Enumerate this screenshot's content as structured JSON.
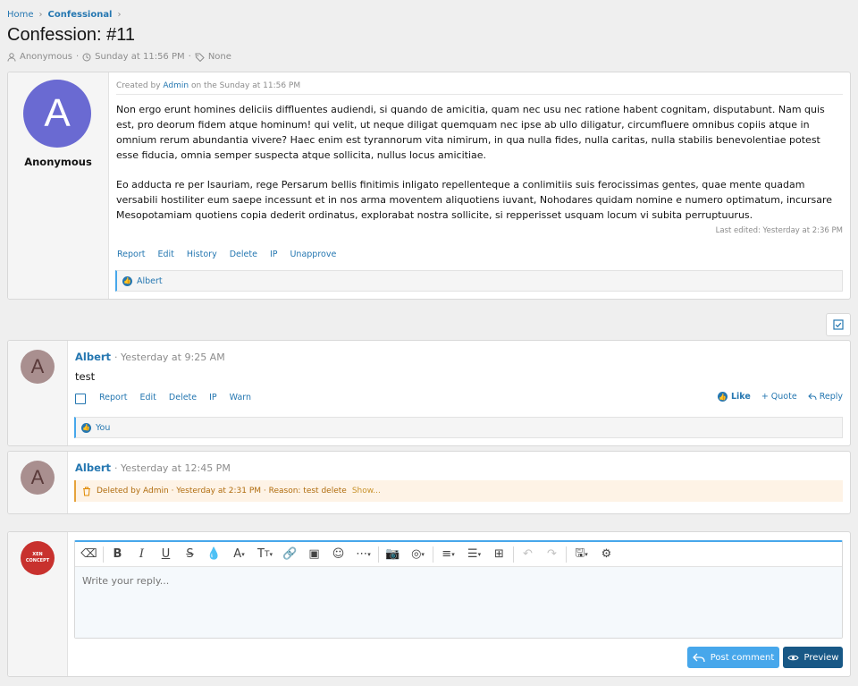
{
  "breadcrumb": {
    "home": "Home",
    "current": "Confessional"
  },
  "page": {
    "title": "Confession: #11",
    "meta_author": "Anonymous",
    "meta_date": "Sunday at 11:56 PM",
    "meta_tags": "None"
  },
  "confession": {
    "avatar_letter": "A",
    "avatar_color": "#6a6ad2",
    "username": "Anonymous",
    "created_prefix": "Created by",
    "created_by": "Admin",
    "created_suffix": "on the Sunday at 11:56 PM",
    "paragraph1": "Non ergo erunt homines deliciis diffluentes audiendi, si quando de amicitia, quam nec usu nec ratione habent cognitam, disputabunt. Nam quis est, pro deorum fidem atque hominum! qui velit, ut neque diligat quemquam nec ipse ab ullo diligatur, circumfluere omnibus copiis atque in omnium rerum abundantia vivere? Haec enim est tyrannorum vita nimirum, in qua nulla fides, nulla caritas, nulla stabilis benevolentiae potest esse fiducia, omnia semper suspecta atque sollicita, nullus locus amicitiae.",
    "paragraph2": "Eo adducta re per Isauriam, rege Persarum bellis finitimis inligato repellenteque a conlimitiis suis ferocissimas gentes, quae mente quadam versabili hostiliter eum saepe incessunt et in nos arma moventem aliquotiens iuvant, Nohodares quidam nomine e numero optimatum, incursare Mesopotamiam quotiens copia dederit ordinatus, explorabat nostra sollicite, si repperisset usquam locum vi subita perruptuurus.",
    "last_edited": "Last edited: Yesterday at 2:36 PM",
    "actions": [
      "Report",
      "Edit",
      "History",
      "Delete",
      "IP",
      "Unapprove"
    ],
    "reaction_user": "Albert"
  },
  "comments": [
    {
      "avatar_letter": "A",
      "author": "Albert",
      "date": "· Yesterday at 9:25 AM",
      "body": "test",
      "actions": [
        "Report",
        "Edit",
        "Delete",
        "IP",
        "Warn"
      ],
      "like_label": "Like",
      "quote_label": "+ Quote",
      "reply_label": "Reply",
      "reaction_user": "You"
    },
    {
      "avatar_letter": "A",
      "author": "Albert",
      "date": "· Yesterday at 12:45 PM",
      "deleted_text": "Deleted by Admin · Yesterday at 2:31 PM · Reason: test delete",
      "show_label": "Show..."
    }
  ],
  "reply": {
    "avatar_text_top": "XEN",
    "avatar_text_bottom": "CONCEPT",
    "placeholder": "Write your reply...",
    "post_label": "Post comment",
    "preview_label": "Preview"
  },
  "colors": {
    "accent": "#2577b1",
    "button_light": "#47a7eb",
    "button_dark": "#185886",
    "deleted_bg": "#fef3e6"
  }
}
